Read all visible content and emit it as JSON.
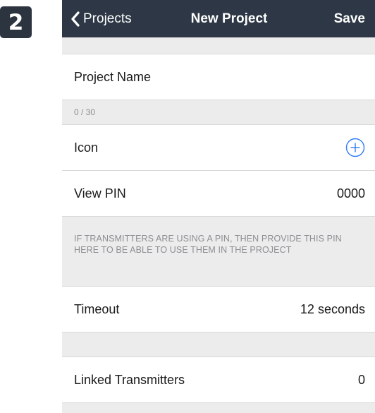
{
  "step": {
    "number": "2"
  },
  "nav": {
    "back_label": "Projects",
    "title": "New Project",
    "save_label": "Save"
  },
  "form": {
    "project_name": {
      "placeholder": "Project Name",
      "counter": "0 / 30"
    },
    "icon": {
      "label": "Icon",
      "action_icon": "plus-circle-icon"
    },
    "view_pin": {
      "label": "View PIN",
      "value": "0000"
    },
    "pin_note": "IF TRANSMITTERS ARE USING A PIN, THEN PROVIDE THIS PIN HERE TO BE ABLE TO USE THEM IN THE PROJECT",
    "timeout": {
      "label": "Timeout",
      "value": "12 seconds"
    },
    "linked_transmitters": {
      "label": "Linked Transmitters",
      "value": "0"
    }
  },
  "colors": {
    "navbar": "#2d3745",
    "accent": "#2f7cf6",
    "group_background": "#ececec",
    "secondary_text": "#8e8e93"
  }
}
